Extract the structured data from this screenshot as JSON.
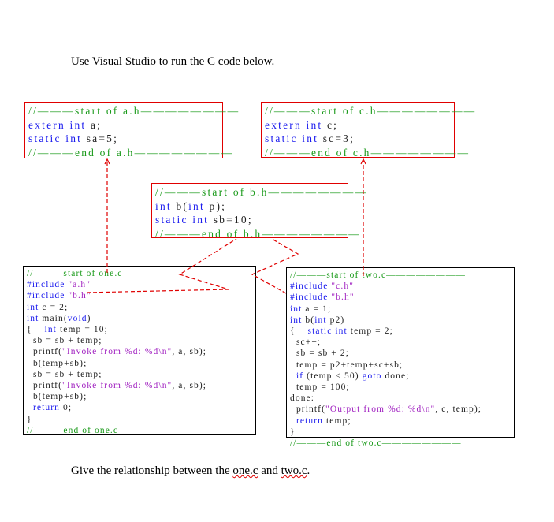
{
  "intro": "Use Visual Studio to run the C code below.",
  "question": {
    "before": "Give the relationship between the ",
    "one": "one.c",
    "mid": " and ",
    "two": "two.c",
    "after": "."
  },
  "colors": {
    "box_border": "#e00000",
    "comment": "#1a9a1a",
    "keyword": "#1a1aee",
    "string": "#a020c0"
  },
  "files": {
    "a_h": [
      [
        [
          "c",
          "//———start of a.h————————"
        ]
      ],
      [
        [
          "k",
          "extern int "
        ],
        [
          "p",
          "a;"
        ]
      ],
      [
        [
          "k",
          "static int "
        ],
        [
          "p",
          "sa=5;"
        ]
      ],
      [
        [
          "c",
          "//———end of a.h————————"
        ]
      ]
    ],
    "c_h": [
      [
        [
          "c",
          "//———start of c.h————————"
        ]
      ],
      [
        [
          "k",
          "extern int "
        ],
        [
          "p",
          "c;"
        ]
      ],
      [
        [
          "k",
          "static int "
        ],
        [
          "p",
          "sc=3;"
        ]
      ],
      [
        [
          "c",
          "//———end of c.h————————"
        ]
      ]
    ],
    "b_h": [
      [
        [
          "c",
          "//———start of b.h————————"
        ]
      ],
      [
        [
          "k",
          "int "
        ],
        [
          "p",
          "b("
        ],
        [
          "k",
          "int "
        ],
        [
          "p",
          "p);"
        ]
      ],
      [
        [
          "k",
          "static int "
        ],
        [
          "p",
          "sb=10;"
        ]
      ],
      [
        [
          "c",
          "//———end of b.h————————"
        ]
      ]
    ],
    "one_c": [
      [
        [
          "c",
          "//———start of one.c————"
        ]
      ],
      [
        [
          "k",
          "#include "
        ],
        [
          "s",
          "\"a.h\""
        ]
      ],
      [
        [
          "k",
          "#include "
        ],
        [
          "s",
          "\"b.h\""
        ]
      ],
      [
        [
          "k",
          "int "
        ],
        [
          "p",
          "c = 2;"
        ]
      ],
      [
        [
          "k",
          "int "
        ],
        [
          "p",
          "main("
        ],
        [
          "k",
          "void"
        ],
        [
          "p",
          ")"
        ]
      ],
      [
        [
          "p",
          "{    "
        ],
        [
          "k",
          "int "
        ],
        [
          "p",
          "temp = 10;"
        ]
      ],
      [
        [
          "p",
          "  sb = sb + temp;"
        ]
      ],
      [
        [
          "p",
          "  printf("
        ],
        [
          "s",
          "\"Invoke from %d: %d\\n\""
        ],
        [
          "p",
          ", a, sb);"
        ]
      ],
      [
        [
          "p",
          "  b(temp+sb);"
        ]
      ],
      [
        [
          "p",
          "  sb = sb + temp;"
        ]
      ],
      [
        [
          "p",
          "  printf("
        ],
        [
          "s",
          "\"Invoke from %d: %d\\n\""
        ],
        [
          "p",
          ", a, sb);"
        ]
      ],
      [
        [
          "p",
          "  b(temp+sb);"
        ]
      ],
      [
        [
          "k",
          "  return "
        ],
        [
          "p",
          "0;"
        ]
      ],
      [
        [
          "p",
          "}"
        ]
      ],
      [
        [
          "c",
          "//———end of one.c————————"
        ]
      ]
    ],
    "two_c": [
      [
        [
          "c",
          "//———start of two.c————————"
        ]
      ],
      [
        [
          "k",
          "#include "
        ],
        [
          "s",
          "\"c.h\""
        ]
      ],
      [
        [
          "k",
          "#include "
        ],
        [
          "s",
          "\"b.h\""
        ]
      ],
      [
        [
          "k",
          "int "
        ],
        [
          "p",
          "a = 1;"
        ]
      ],
      [
        [
          "k",
          "int "
        ],
        [
          "p",
          "b("
        ],
        [
          "k",
          "int "
        ],
        [
          "p",
          "p2)"
        ]
      ],
      [
        [
          "p",
          "{    "
        ],
        [
          "k",
          "static int "
        ],
        [
          "p",
          "temp = 2;"
        ]
      ],
      [
        [
          "p",
          "  sc++;"
        ]
      ],
      [
        [
          "p",
          "  sb = sb + 2;"
        ]
      ],
      [
        [
          "p",
          "  temp = p2+temp+sc+sb;"
        ]
      ],
      [
        [
          "k",
          "  if "
        ],
        [
          "p",
          "(temp < 50) "
        ],
        [
          "k",
          "goto "
        ],
        [
          "p",
          "done;"
        ]
      ],
      [
        [
          "p",
          "  temp = 100;"
        ]
      ],
      [
        [
          "p",
          "done:"
        ]
      ],
      [
        [
          "p",
          "  printf("
        ],
        [
          "s",
          "\"Output from %d: %d\\n\""
        ],
        [
          "p",
          ", c, temp);"
        ]
      ],
      [
        [
          "k",
          "  return "
        ],
        [
          "p",
          "temp;"
        ]
      ],
      [
        [
          "p",
          "}"
        ]
      ],
      [
        [
          "c",
          "//———end of two.c————————"
        ]
      ]
    ]
  }
}
